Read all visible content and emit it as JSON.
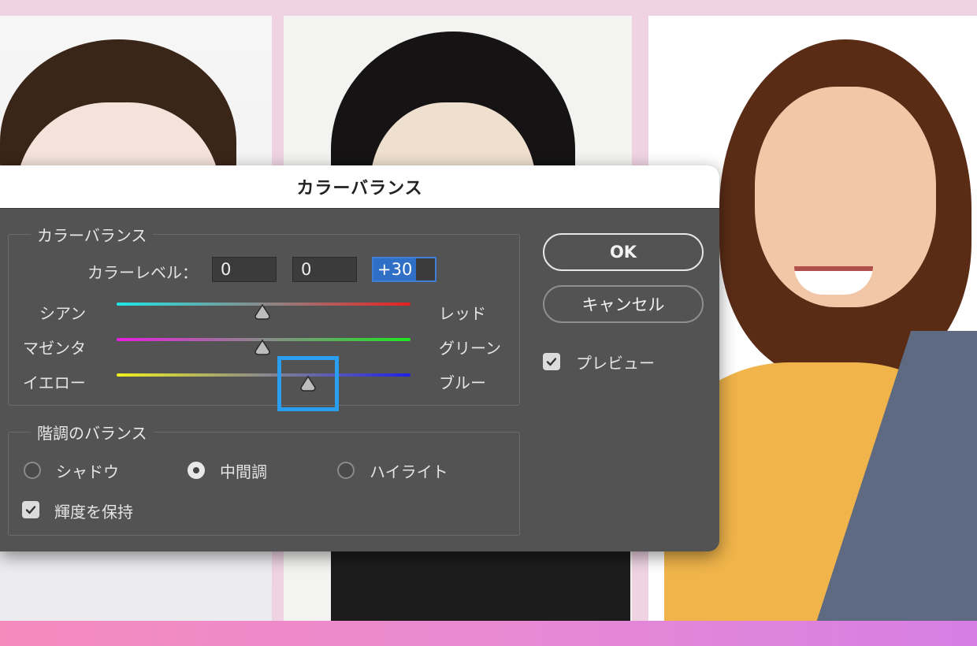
{
  "dialog": {
    "title": "カラーバランス",
    "color_balance_group": {
      "label": "カラーバランス",
      "levels_label": "カラーレベル：",
      "levels": [
        "0",
        "0",
        "+30"
      ],
      "sliders": [
        {
          "left": "シアン",
          "right": "レッド",
          "value": 0,
          "left_color": "#1ee6e6",
          "right_color": "#e82020"
        },
        {
          "left": "マゼンタ",
          "right": "グリーン",
          "value": 0,
          "left_color": "#e81ee0",
          "right_color": "#1ee620"
        },
        {
          "left": "イエロー",
          "right": "ブルー",
          "value": 30,
          "left_color": "#f0f01e",
          "right_color": "#2020e8"
        }
      ]
    },
    "tone_balance_group": {
      "label": "階調のバランス",
      "options": [
        "シャドウ",
        "中間調",
        "ハイライト"
      ],
      "selected": "中間調",
      "preserve_luminosity_label": "輝度を保持",
      "preserve_luminosity": true
    },
    "ok_label": "OK",
    "cancel_label": "キャンセル",
    "preview_label": "プレビュー",
    "preview": true
  },
  "colors": {
    "highlight": "#2a9ef0",
    "dialog_bg": "#535353"
  }
}
